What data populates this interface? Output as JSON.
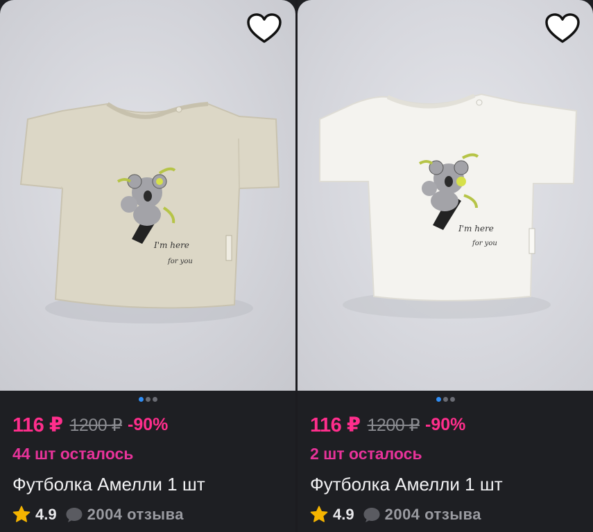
{
  "products": [
    {
      "price": "116 ₽",
      "old_price": "1200 ₽",
      "discount": "-90%",
      "stock": "44 шт осталось",
      "title": "Футболка Амелли 1 шт",
      "rating": "4.9",
      "reviews": "2004 отзыва",
      "shirt_color": "#dcd7c6",
      "image_text": [
        "I'm here",
        "for you"
      ],
      "favorite_icon": "heart-outline-icon",
      "gallery_dots": 3,
      "gallery_active": 1
    },
    {
      "price": "116 ₽",
      "old_price": "1200 ₽",
      "discount": "-90%",
      "stock": "2 шт осталось",
      "title": "Футболка Амелли 1 шт",
      "rating": "4.9",
      "reviews": "2004 отзыва",
      "shirt_color": "#f4f3ef",
      "image_text": [
        "I'm here",
        "for you"
      ],
      "favorite_icon": "heart-outline-icon",
      "gallery_dots": 3,
      "gallery_active": 1
    }
  ],
  "colors": {
    "accent_pink": "#ff2e8c",
    "card_bg": "#1e1f23",
    "star": "#f5b400",
    "dot_active": "#2f8df5"
  }
}
